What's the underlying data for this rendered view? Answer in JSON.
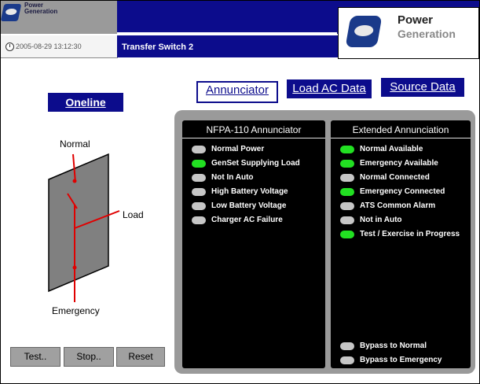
{
  "header": {
    "small_logo_line1": "Power",
    "small_logo_line2": "Generation",
    "timestamp": "2005-08-29 13:12:30",
    "title": "Transfer Switch 2",
    "brand_line1": "Power",
    "brand_line2": "Generation"
  },
  "tabs": {
    "annunciator": "Annunciator",
    "load_ac": "Load AC Data",
    "source": "Source Data"
  },
  "oneline": {
    "button": "Oneline",
    "normal_label": "Normal",
    "load_label": "Load",
    "emergency_label": "Emergency"
  },
  "buttons": {
    "test": "Test..",
    "stop": "Stop..",
    "reset": "Reset"
  },
  "nfpa": {
    "title": "NFPA-110 Annunciator",
    "items": [
      {
        "label": "Normal Power",
        "state": "off"
      },
      {
        "label": "GenSet Supplying Load",
        "state": "on"
      },
      {
        "label": "Not In Auto",
        "state": "off"
      },
      {
        "label": "High Battery Voltage",
        "state": "off"
      },
      {
        "label": "Low Battery Voltage",
        "state": "off"
      },
      {
        "label": "Charger AC Failure",
        "state": "off"
      }
    ]
  },
  "extended": {
    "title": "Extended Annunciation",
    "items": [
      {
        "label": "Normal Available",
        "state": "on"
      },
      {
        "label": "Emergency Available",
        "state": "on"
      },
      {
        "label": "Normal Connected",
        "state": "off"
      },
      {
        "label": "Emergency Connected",
        "state": "on"
      },
      {
        "label": "ATS Common Alarm",
        "state": "off"
      },
      {
        "label": "Not in Auto",
        "state": "off"
      },
      {
        "label": "Test / Exercise in Progress",
        "state": "on"
      }
    ],
    "bypass_items": [
      {
        "label": "Bypass to Normal",
        "state": "off"
      },
      {
        "label": "Bypass to Emergency",
        "state": "off"
      }
    ]
  },
  "colors": {
    "header_blue": "#0c0c8c",
    "led_on": "#22e022",
    "led_off": "#c6c6c6",
    "line_red": "#e00000"
  }
}
